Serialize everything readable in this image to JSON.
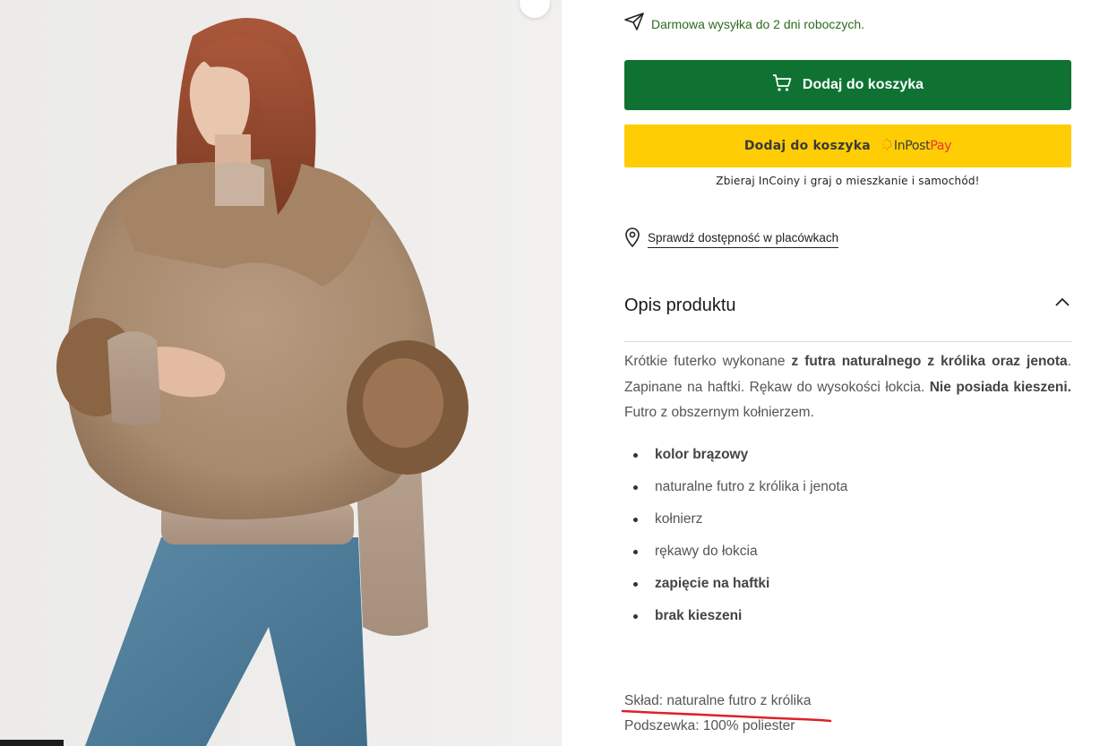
{
  "product_image": {
    "alt": ""
  },
  "shipping": {
    "text": "Darmowa wysyłka do 2 dni roboczych."
  },
  "cart_button": {
    "label": "Dodaj do koszyka"
  },
  "inpost_button": {
    "label": "Dodaj do koszyka",
    "logo_in": "InPost",
    "logo_pay": "Pay"
  },
  "incoins": {
    "text": "Zbieraj InCoiny i graj o mieszkanie i samochód!"
  },
  "availability": {
    "link": "Sprawdź dostępność w placówkach"
  },
  "description": {
    "title": "Opis produktu",
    "p1": "Krótkie futerko wykonane ",
    "p1_bold": "z futra naturalnego z królika oraz jenota",
    "p2": ". Zapinane na haftki. Rękaw do wysokości łokcia. ",
    "p2_bold": "Nie posiada kieszeni.",
    "p3": " Futro z obszernym kołnierzem.",
    "features": [
      {
        "label": "kolor brązowy",
        "bold": true
      },
      {
        "label": "naturalne futro z królika i jenota",
        "bold": false
      },
      {
        "label": "kołnierz",
        "bold": false
      },
      {
        "label": "rękawy do łokcia",
        "bold": false
      },
      {
        "label": "zapięcie na haftki",
        "bold": true
      },
      {
        "label": "brak kieszeni",
        "bold": true
      }
    ],
    "composition": "Skład: naturalne futro z królika",
    "lining": "Podszewka: 100% poliester"
  },
  "colors": {
    "cart_green": "#0f7233",
    "inpost_yellow": "#ffcd03",
    "shipping_green": "#2e6b1e",
    "annotation_red": "#e0202a"
  }
}
